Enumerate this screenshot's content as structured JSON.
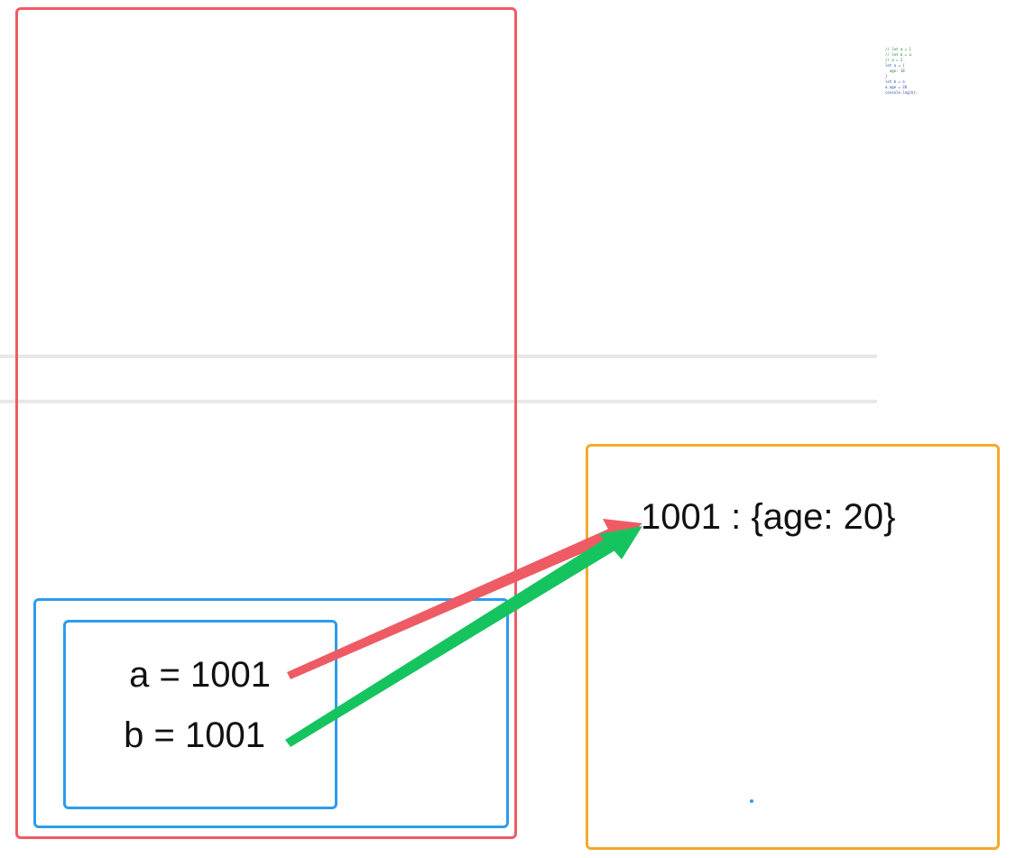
{
  "stack": {
    "variables": [
      {
        "text": "a = 1001"
      },
      {
        "text": "b = 1001"
      }
    ]
  },
  "heap": {
    "entry": "1001 : {age: 20}"
  },
  "code_thumbnail": {
    "lines": [
      "// let a = 1",
      "// let b = a",
      "// a = 2",
      "let a = {",
      "  age: 18",
      "}",
      "let b = a",
      "a.age = 20",
      "console.log(b);"
    ]
  },
  "colors": {
    "stack_border": "#ee5b65",
    "heap_border": "#f2aa2b",
    "scope_border": "#2d9cec",
    "arrow_a": "#ee5b65",
    "arrow_b": "#16c45f"
  }
}
